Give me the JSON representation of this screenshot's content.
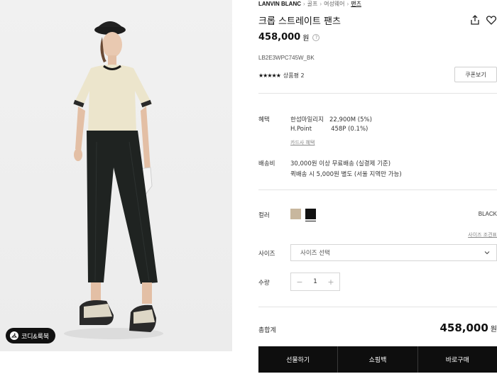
{
  "breadcrumb": {
    "brand": "LANVIN BLANC",
    "items": [
      "골프",
      "여성웨어",
      "팬츠"
    ]
  },
  "product": {
    "title": "크롭 스트레이트 팬츠",
    "price": "458,000",
    "price_unit": "원",
    "sku": "LB2E3WPC745W_BK",
    "rating_stars": "★★★★★",
    "review_label": "상품평 2",
    "coupon_label": "쿠폰보기"
  },
  "benefits": {
    "label": "혜택",
    "line1": "한섬마일리지   22,900M (5%)",
    "line2": "H.Point          458P (0.1%)",
    "card_link": "카드사 혜택"
  },
  "shipping": {
    "label": "배송비",
    "line1": "30,000원 이상 무료배송 (실결제 기준)",
    "line2": "퀵배송 시 5,000원 별도 (서울 지역만 가능)"
  },
  "color": {
    "label": "컬러",
    "selected_name": "BLACK",
    "size_guide_link": "사이즈 조견표",
    "swatches": [
      "#c8b79e",
      "#111111"
    ]
  },
  "size": {
    "label": "사이즈",
    "placeholder": "사이즈 선택"
  },
  "quantity": {
    "label": "수량",
    "value": "1",
    "minus": "−",
    "plus": "+"
  },
  "total": {
    "label": "총합계",
    "price": "458,000",
    "unit": "원"
  },
  "actions": {
    "gift": "선물하기",
    "cart": "쇼핑백",
    "buy": "바로구매"
  },
  "image_button": {
    "label": "코디&룩북"
  }
}
